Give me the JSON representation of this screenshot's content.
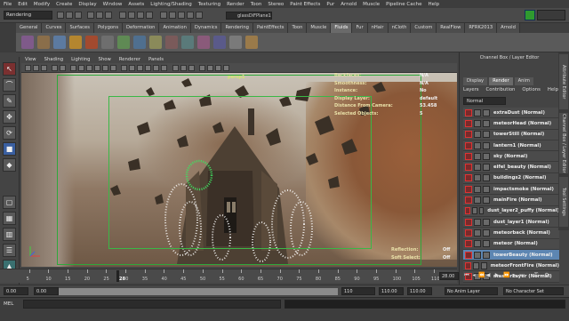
{
  "menubar": [
    "File",
    "Edit",
    "Modify",
    "Create",
    "Display",
    "Window",
    "Assets",
    "Lighting/Shading",
    "Texturing",
    "Render",
    "Toon",
    "Stereo",
    "Paint Effects",
    "Pur",
    "Arnold",
    "Muscle",
    "Pipeline Cache",
    "Help"
  ],
  "status": {
    "mode": "Rendering",
    "object_field": "glassDiFPlane1"
  },
  "shelf_tabs": [
    "General",
    "Curves",
    "Surfaces",
    "Polygons",
    "Deformation",
    "Animation",
    "Dynamics",
    "Rendering",
    "PaintEffects",
    "Toon",
    "Muscle",
    "Fluids",
    "Fur",
    "nHair",
    "nCloth",
    "Custom",
    "RealFlow",
    "RFRK2013",
    "Arnold"
  ],
  "shelf_active": "Fluids",
  "panel_menu": [
    "View",
    "Shading",
    "Lighting",
    "Show",
    "Renderer",
    "Panels"
  ],
  "viewport": {
    "panel_name": "persp1",
    "hud": [
      {
        "key": "Backfaces:",
        "val": "N/A"
      },
      {
        "key": "Smoothness:",
        "val": "N/A"
      },
      {
        "key": "Instance:",
        "val": "No"
      },
      {
        "key": "Display Layer:",
        "val": "default"
      },
      {
        "key": "Distance From Camera:",
        "val": "53.458"
      },
      {
        "key": "Selected Objects:",
        "val": "5"
      }
    ],
    "hud_bottom": [
      {
        "key": "Reflection:",
        "val": "Off"
      },
      {
        "key": "Soft Select:",
        "val": "Off"
      }
    ]
  },
  "channel_box": {
    "title": "Channel Box / Layer Editor",
    "tabs": [
      "Display",
      "Render",
      "Anim"
    ],
    "active_tab": "Render",
    "submenu": [
      "Layers",
      "Contribution",
      "Options",
      "Help"
    ],
    "blend_mode": "Normal",
    "layers": [
      {
        "name": "extraDust (Normal)",
        "selected": false
      },
      {
        "name": "meteorHead (Normal)",
        "selected": false
      },
      {
        "name": "towerStill (Normal)",
        "selected": false
      },
      {
        "name": "lantern1 (Normal)",
        "selected": false
      },
      {
        "name": "sky (Normal)",
        "selected": false
      },
      {
        "name": "eifel_beauty (Normal)",
        "selected": false
      },
      {
        "name": "buildings2 (Normal)",
        "selected": false
      },
      {
        "name": "impactsmoke (Normal)",
        "selected": false
      },
      {
        "name": "mainFire (Normal)",
        "selected": false
      },
      {
        "name": "dust_layer2_puffy (Normal)",
        "selected": false
      },
      {
        "name": "dust_layer1 (Normal)",
        "selected": false
      },
      {
        "name": "meteorback (Normal)",
        "selected": false
      },
      {
        "name": "meteor (Normal)",
        "selected": false
      },
      {
        "name": "towerBeauty (Normal)",
        "selected": true
      },
      {
        "name": "meteorFrontFire (Normal)",
        "selected": false
      },
      {
        "name": "masterLayer (Normal)",
        "selected": false
      }
    ]
  },
  "side_tabs": [
    "Attribute Editor",
    "Channel Box / Layer Editor",
    "Tool Settings"
  ],
  "timeline": {
    "ticks": [
      "5",
      "10",
      "15",
      "20",
      "25",
      "30",
      "35",
      "40",
      "45",
      "50",
      "55",
      "60",
      "65",
      "70",
      "75",
      "80",
      "85",
      "90",
      "95",
      "100",
      "105",
      "110"
    ],
    "current_frame": "28",
    "current_frame_box": "28.00"
  },
  "range": {
    "start": "0.00",
    "inner_start": "0.00",
    "inner_end": "110",
    "end": "110.00",
    "end2": "110.00",
    "anim_layer": "No Anim Layer",
    "char_set": "No Character Set"
  },
  "cmd": {
    "label": "MEL"
  }
}
